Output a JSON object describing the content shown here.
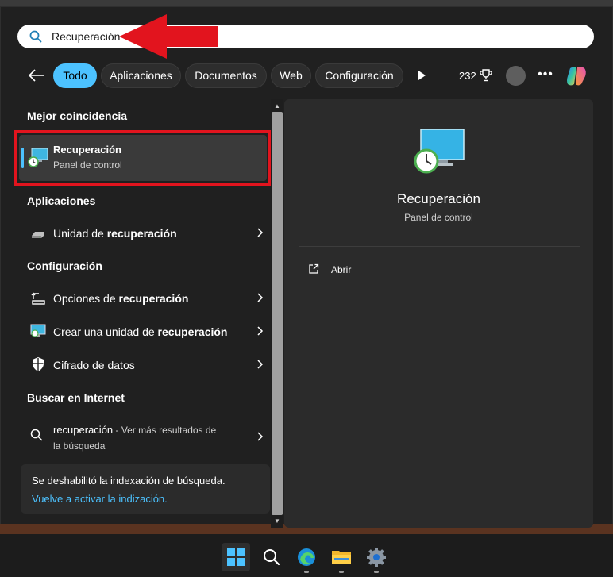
{
  "search": {
    "value": "Recuperación"
  },
  "filters": {
    "tabs": [
      {
        "label": "Todo",
        "active": true
      },
      {
        "label": "Aplicaciones",
        "active": false
      },
      {
        "label": "Documentos",
        "active": false
      },
      {
        "label": "Web",
        "active": false
      },
      {
        "label": "Configuración",
        "active": false
      }
    ],
    "points": "232"
  },
  "results": {
    "best_match_title": "Mejor coincidencia",
    "best_match": {
      "title": "Recuperación",
      "subtitle": "Panel de control",
      "icon": "recovery-monitor-clock-icon"
    },
    "apps_title": "Aplicaciones",
    "apps": [
      {
        "prefix": "Unidad de ",
        "bold": "recuperación",
        "icon": "drive-icon"
      }
    ],
    "settings_title": "Configuración",
    "settings": [
      {
        "prefix": "Opciones de ",
        "bold": "recuperación",
        "icon": "recovery-options-icon"
      },
      {
        "prefix": "Crear una unidad de ",
        "bold": "recuperación",
        "icon": "recovery-drive-monitor-icon"
      },
      {
        "prefix": "Cifrado de datos",
        "bold": "",
        "icon": "shield-icon"
      }
    ],
    "web_title": "Buscar en Internet",
    "web": {
      "query": "recuperación",
      "suffix": " - Ver más resultados de",
      "line2": "la búsqueda"
    },
    "notice": {
      "text": "Se deshabilitó la indexación de búsqueda.",
      "link": "Vuelve a activar la indización."
    }
  },
  "detail": {
    "title": "Recuperación",
    "subtitle": "Panel de control",
    "action": "Abrir"
  },
  "taskbar": {
    "items": [
      "windows-start",
      "search",
      "edge",
      "file-explorer",
      "settings"
    ]
  },
  "colors": {
    "accent": "#4cc2ff",
    "highlight_border": "#e2141e",
    "annotation_arrow": "#e2141e"
  }
}
